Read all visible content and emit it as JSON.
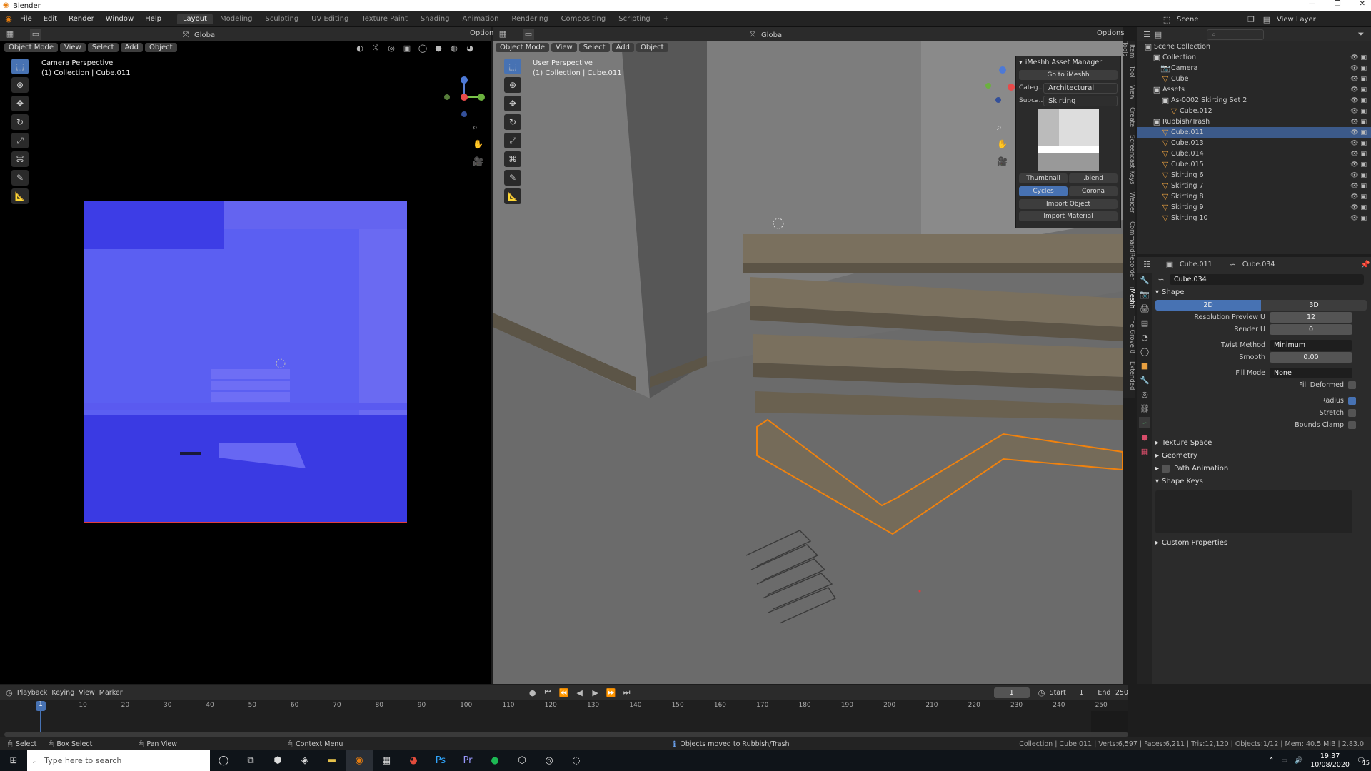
{
  "window": {
    "title": "Blender",
    "controls": [
      "—",
      "❐",
      "✕"
    ]
  },
  "menu": [
    "File",
    "Edit",
    "Render",
    "Window",
    "Help"
  ],
  "workspaces": [
    "Layout",
    "Modeling",
    "Sculpting",
    "UV Editing",
    "Texture Paint",
    "Shading",
    "Animation",
    "Rendering",
    "Compositing",
    "Scripting"
  ],
  "scene": {
    "label": "Scene",
    "view_layer": "View Layer"
  },
  "camera_view": {
    "mode": "Object Mode",
    "menus": [
      "View",
      "Select",
      "Add",
      "Object"
    ],
    "transform": "Global",
    "options": "Options",
    "title": "Camera Perspective",
    "subtitle": "(1) Collection | Cube.011"
  },
  "view3d": {
    "mode": "Object Mode",
    "menus": [
      "View",
      "Select",
      "Add",
      "Object"
    ],
    "transform": "Global",
    "options": "Options",
    "title": "User Perspective",
    "subtitle": "(1) Collection | Cube.011",
    "side_tabs": [
      "Item",
      "Tool",
      "View",
      "Create",
      "Screencast Keys",
      "Weider",
      "CommandRecorder",
      "iMeshh",
      "The Grove 8",
      "Extended Tools"
    ]
  },
  "imesh": {
    "title": "iMeshh Asset Manager",
    "goto": "Go to iMeshh",
    "category_label": "Categ...",
    "category_value": "Architectural",
    "subcat_label": "Subca...",
    "subcat_value": "Skirting",
    "thumb_btn": "Thumbnail",
    "blend_btn": ".blend",
    "engine_a": "Cycles",
    "engine_b": "Corona",
    "import_object": "Import Object",
    "import_material": "Import Material"
  },
  "outliner": {
    "root": "Scene Collection",
    "rows": [
      {
        "label": "Collection",
        "indent": 1,
        "sel": false
      },
      {
        "label": "Camera",
        "indent": 2,
        "sel": false
      },
      {
        "label": "Cube",
        "indent": 2,
        "sel": false
      },
      {
        "label": "Assets",
        "indent": 1,
        "sel": false
      },
      {
        "label": "As-0002 Skirting Set 2",
        "indent": 2,
        "sel": false
      },
      {
        "label": "Cube.012",
        "indent": 3,
        "sel": false
      },
      {
        "label": "Rubbish/Trash",
        "indent": 1,
        "sel": false
      },
      {
        "label": "Cube.011",
        "indent": 2,
        "sel": true
      },
      {
        "label": "Cube.013",
        "indent": 2,
        "sel": false
      },
      {
        "label": "Cube.014",
        "indent": 2,
        "sel": false
      },
      {
        "label": "Cube.015",
        "indent": 2,
        "sel": false
      },
      {
        "label": "Skirting 6",
        "indent": 2,
        "sel": false
      },
      {
        "label": "Skirting 7",
        "indent": 2,
        "sel": false
      },
      {
        "label": "Skirting 8",
        "indent": 2,
        "sel": false
      },
      {
        "label": "Skirting 9",
        "indent": 2,
        "sel": false
      },
      {
        "label": "Skirting 10",
        "indent": 2,
        "sel": false
      }
    ]
  },
  "props": {
    "object": "Cube.011",
    "data": "Cube.034",
    "datablock": "Cube.034",
    "shape_panel": "Shape",
    "dim_2d": "2D",
    "dim_3d": "3D",
    "fields": [
      {
        "label": "Resolution Preview U",
        "value": "12"
      },
      {
        "label": "Render U",
        "value": "0"
      }
    ],
    "twist_label": "Twist Method",
    "twist_value": "Minimum",
    "smooth_label": "Smooth",
    "smooth_value": "0.00",
    "fill_label": "Fill Mode",
    "fill_value": "None",
    "fill_deformed": "Fill Deformed",
    "radius": "Radius",
    "stretch": "Stretch",
    "bounds_clamp": "Bounds Clamp",
    "texture_space": "Texture Space",
    "geometry": "Geometry",
    "path_animation": "Path Animation",
    "shape_keys": "Shape Keys",
    "custom_props": "Custom Properties"
  },
  "timeline": {
    "menus": [
      "Playback",
      "Keying",
      "View",
      "Marker"
    ],
    "current": "1",
    "start_label": "Start",
    "start": "1",
    "end_label": "End",
    "end": "250",
    "ticks": [
      "1",
      "10",
      "20",
      "30",
      "40",
      "50",
      "60",
      "70",
      "80",
      "90",
      "100",
      "110",
      "120",
      "130",
      "140",
      "150",
      "160",
      "170",
      "180",
      "190",
      "200",
      "210",
      "220",
      "230",
      "240",
      "250"
    ]
  },
  "status": {
    "select": "Select",
    "box_select": "Box Select",
    "pan_view": "Pan View",
    "context_menu": "Context Menu",
    "message": "Objects moved to Rubbish/Trash",
    "stats": "Collection | Cube.011 | Verts:6,597 | Faces:6,211 | Tris:12,120 | Objects:1/12 | Mem: 40.5 MiB | 2.83.0"
  },
  "taskbar": {
    "search_placeholder": "Type here to search",
    "time": "19:37",
    "date": "10/08/2020",
    "notif": "15"
  }
}
